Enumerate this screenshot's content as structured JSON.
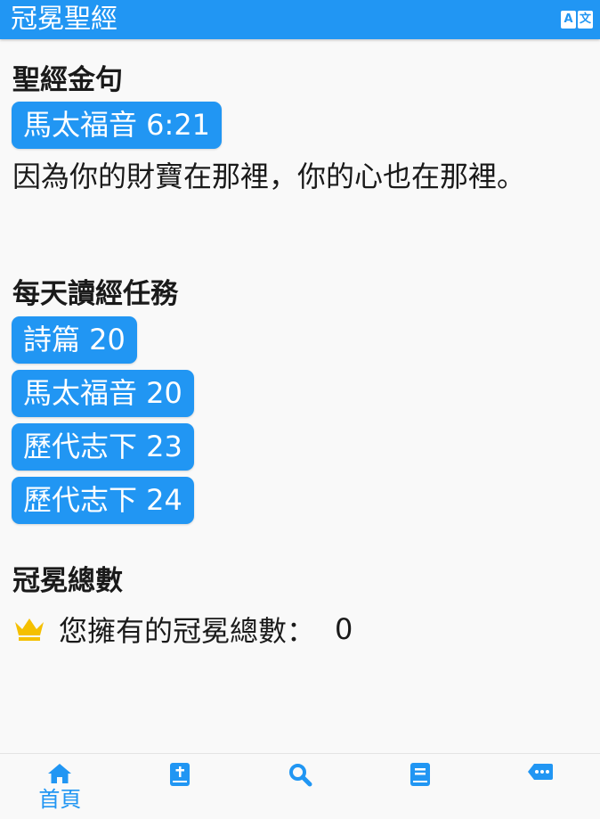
{
  "app": {
    "title": "冠冕聖經",
    "translate_icon": "translate-icon",
    "translate_glyph_a": "A",
    "translate_glyph_b": "文"
  },
  "verse_section": {
    "title": "聖經金句",
    "reference": "馬太福音 6:21",
    "text": "因為你的財寶在那裡，你的心也在那裡。"
  },
  "tasks_section": {
    "title": "每天讀經任務",
    "items": [
      {
        "label": "詩篇 20"
      },
      {
        "label": "馬太福音 20"
      },
      {
        "label": "歷代志下 23"
      },
      {
        "label": "歷代志下 24"
      }
    ]
  },
  "crown_section": {
    "title": "冠冕總數",
    "icon": "crown-icon",
    "label": "您擁有的冠冕總數：",
    "count": "0"
  },
  "bottom_nav": {
    "items": [
      {
        "icon": "home-icon",
        "label": "首頁",
        "active": true
      },
      {
        "icon": "bible-icon",
        "label": ""
      },
      {
        "icon": "search-icon",
        "label": ""
      },
      {
        "icon": "book-icon",
        "label": ""
      },
      {
        "icon": "message-icon",
        "label": ""
      }
    ]
  },
  "colors": {
    "primary": "#2196f3",
    "crown": "#f5c000",
    "background": "#f9f9f9",
    "text": "#1a1a1a"
  }
}
